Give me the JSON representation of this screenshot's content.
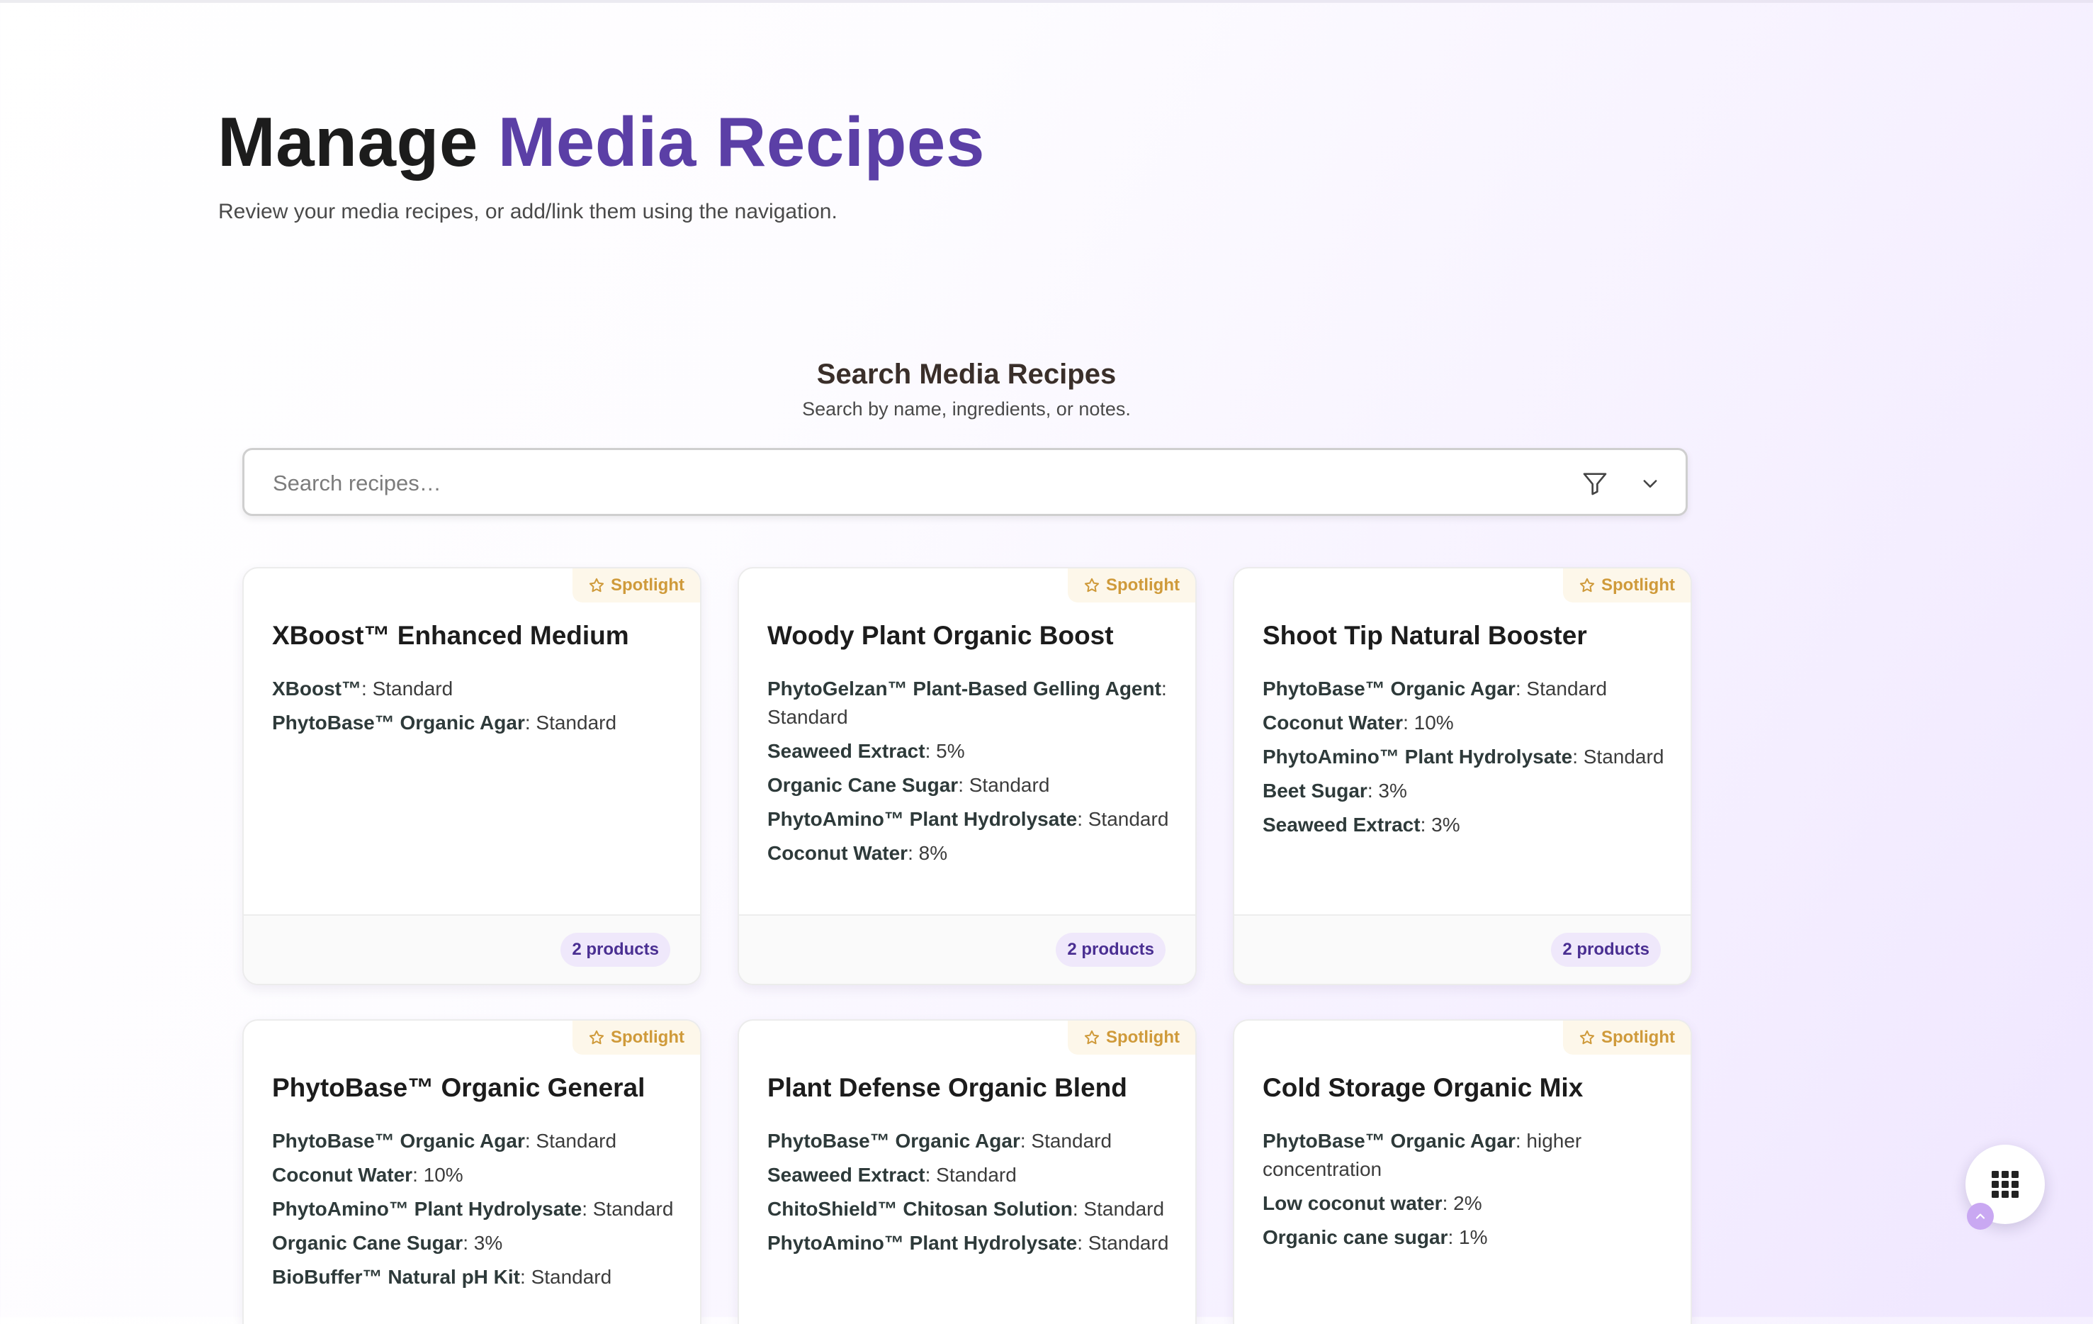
{
  "header": {
    "title_main": "Manage",
    "title_accent": "Media Recipes",
    "subtitle": "Review your media recipes, or add/link them using the navigation."
  },
  "search": {
    "title": "Search Media Recipes",
    "subtitle": "Search by name, ingredients, or notes.",
    "placeholder": "Search recipes…",
    "value": ""
  },
  "icons": {
    "filter": "filter-funnel-icon",
    "expand": "chevron-down-icon",
    "spotlight": "star-outline-icon",
    "apps": "grid-apps-icon",
    "scroll_up": "chevron-up-icon"
  },
  "colors": {
    "accent": "#5b3fa6",
    "spotlight_text": "#cf9a3a",
    "badge_bg": "#efe8fb",
    "badge_text": "#4a2f92"
  },
  "recipes": [
    {
      "spotlight_label": "Spotlight",
      "name": "XBoost™ Enhanced Medium",
      "ingredients": [
        {
          "name": "XBoost™",
          "amount": "Standard"
        },
        {
          "name": "PhytoBase™ Organic Agar",
          "amount": "Standard"
        }
      ],
      "products_label": "2 products"
    },
    {
      "spotlight_label": "Spotlight",
      "name": "Woody Plant Organic Boost",
      "ingredients": [
        {
          "name": "PhytoGelzan™ Plant-Based Gelling Agent",
          "amount": "Standard"
        },
        {
          "name": "Seaweed Extract",
          "amount": "5%"
        },
        {
          "name": "Organic Cane Sugar",
          "amount": "Standard"
        },
        {
          "name": "PhytoAmino™ Plant Hydrolysate",
          "amount": "Standard"
        },
        {
          "name": "Coconut Water",
          "amount": "8%"
        }
      ],
      "products_label": "2 products"
    },
    {
      "spotlight_label": "Spotlight",
      "name": "Shoot Tip Natural Booster",
      "ingredients": [
        {
          "name": "PhytoBase™ Organic Agar",
          "amount": "Standard"
        },
        {
          "name": "Coconut Water",
          "amount": "10%"
        },
        {
          "name": "PhytoAmino™ Plant Hydrolysate",
          "amount": "Standard"
        },
        {
          "name": "Beet Sugar",
          "amount": "3%"
        },
        {
          "name": "Seaweed Extract",
          "amount": "3%"
        }
      ],
      "products_label": "2 products"
    },
    {
      "spotlight_label": "Spotlight",
      "name": "PhytoBase™ Organic General",
      "ingredients": [
        {
          "name": "PhytoBase™ Organic Agar",
          "amount": "Standard"
        },
        {
          "name": "Coconut Water",
          "amount": "10%"
        },
        {
          "name": "PhytoAmino™ Plant Hydrolysate",
          "amount": "Standard"
        },
        {
          "name": "Organic Cane Sugar",
          "amount": "3%"
        },
        {
          "name": "BioBuffer™ Natural pH Kit",
          "amount": "Standard"
        }
      ]
    },
    {
      "spotlight_label": "Spotlight",
      "name": "Plant Defense Organic Blend",
      "ingredients": [
        {
          "name": "PhytoBase™ Organic Agar",
          "amount": "Standard"
        },
        {
          "name": "Seaweed Extract",
          "amount": "Standard"
        },
        {
          "name": "ChitoShield™ Chitosan Solution",
          "amount": "Standard"
        },
        {
          "name": "PhytoAmino™ Plant Hydrolysate",
          "amount": "Standard"
        }
      ]
    },
    {
      "spotlight_label": "Spotlight",
      "name": "Cold Storage Organic Mix",
      "ingredients": [
        {
          "name": "PhytoBase™ Organic Agar",
          "amount": "higher concentration"
        },
        {
          "name": "Low coconut water",
          "amount": "2%"
        },
        {
          "name": "Organic cane sugar",
          "amount": "1%"
        }
      ]
    }
  ]
}
